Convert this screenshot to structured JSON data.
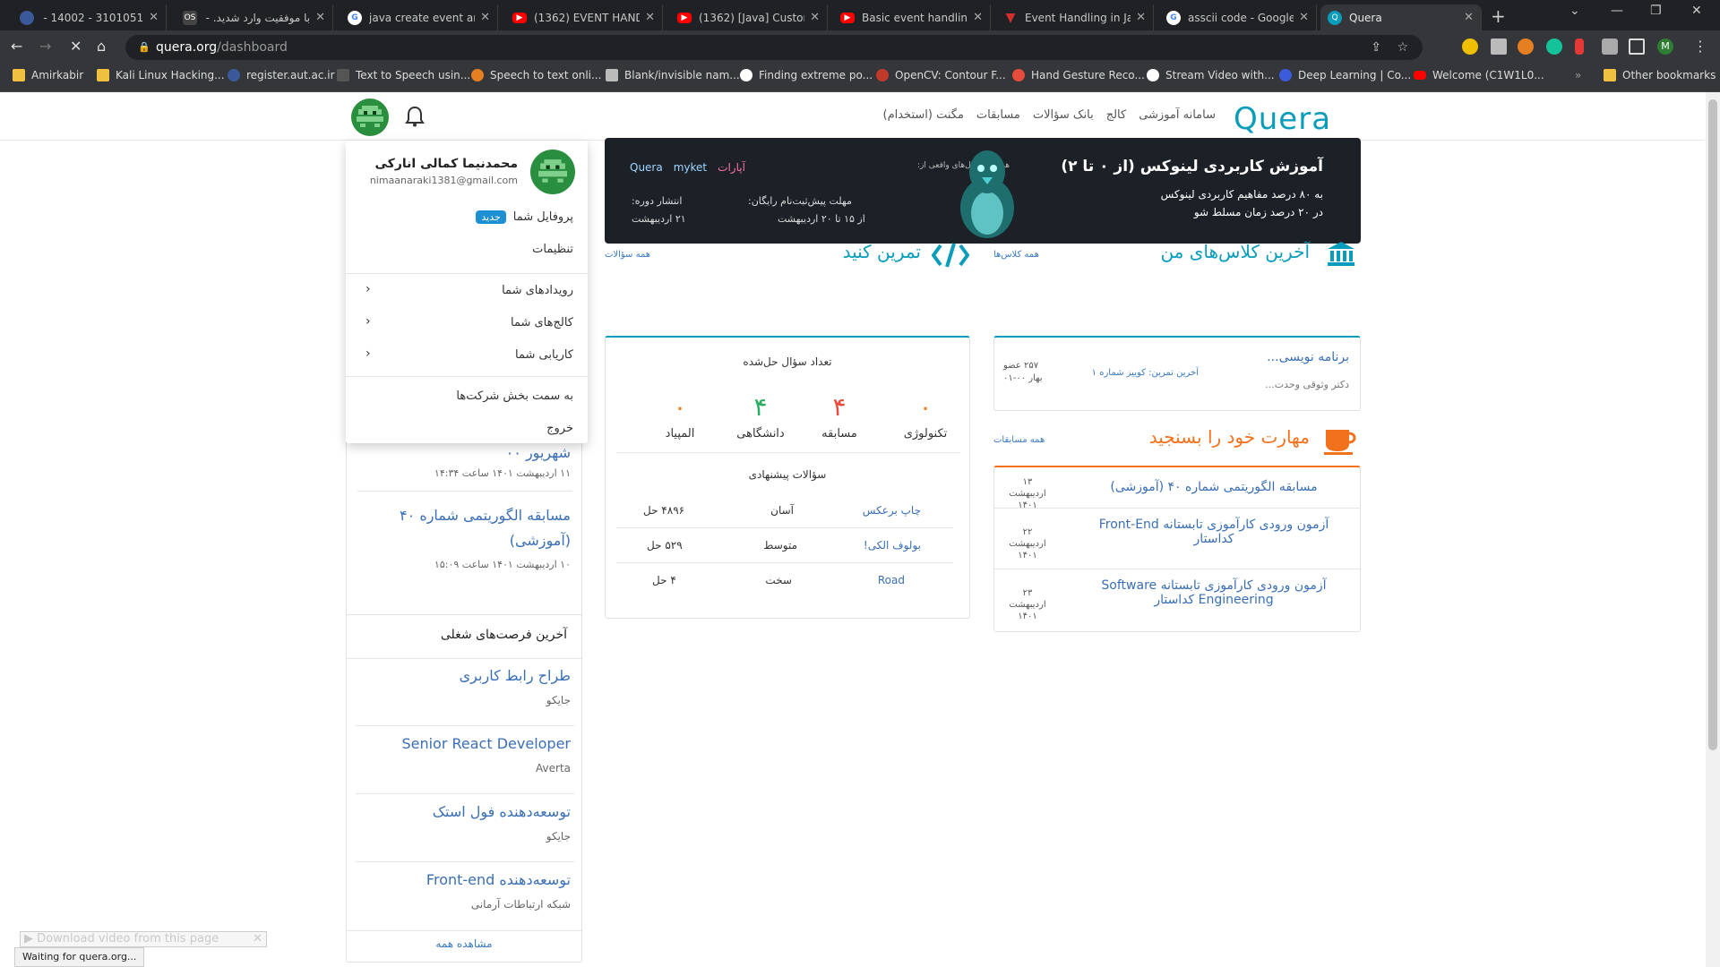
{
  "browser": {
    "tabs": [
      {
        "title": "3101051 - 14002 - کار",
        "icon": "aut-icon",
        "color": "#3b5998"
      },
      {
        "title": "با موفقیت وارد شدید. -",
        "icon": "os-icon",
        "color": "#444444"
      },
      {
        "title": "java create event and l",
        "icon": "google-icon",
        "color": "#4285f4"
      },
      {
        "title": "(1362) EVENT HANDLI",
        "icon": "youtube-icon",
        "color": "#ff0000"
      },
      {
        "title": "(1362) [Java] Custom E",
        "icon": "youtube-icon",
        "color": "#ff0000"
      },
      {
        "title": "Basic event handling i",
        "icon": "youtube-icon",
        "color": "#ff0000"
      },
      {
        "title": "Event Handling in Java",
        "icon": "v-icon",
        "color": "#d32f2f"
      },
      {
        "title": "asscii code - Google S",
        "icon": "google-icon",
        "color": "#4285f4"
      },
      {
        "title": "Quera",
        "icon": "quera-icon",
        "color": "#0a9dbb"
      }
    ],
    "url_host": "quera.org",
    "url_path": "/dashboard",
    "bookmarks": [
      {
        "label": "Amirkabir",
        "color": "#f0c040"
      },
      {
        "label": "Kali Linux Hacking...",
        "color": "#f0c040"
      },
      {
        "label": "register.aut.ac.ir",
        "color": "#3b5998"
      },
      {
        "label": "Text to Speech usin...",
        "color": "#555555"
      },
      {
        "label": "Speech to text onli...",
        "color": "#e67e22"
      },
      {
        "label": "Blank/invisible nam...",
        "color": "#bbbbbb"
      },
      {
        "label": "Finding extreme po...",
        "color": "#ffffff"
      },
      {
        "label": "OpenCV: Contour F...",
        "color": "#c0392b"
      },
      {
        "label": "Hand Gesture Reco...",
        "color": "#e74c3c"
      },
      {
        "label": "Stream Video with...",
        "color": "#ffffff"
      },
      {
        "label": "Deep Learning | Co...",
        "color": "#3b5bdb"
      },
      {
        "label": "Welcome (C1W1L0...",
        "color": "#ff0000"
      }
    ],
    "other_bookmarks": "Other bookmarks",
    "status_text": "Waiting for quera.org...",
    "download_bar": "Download video from this page"
  },
  "header": {
    "logo": "Quera",
    "menu": [
      "سامانه آموزشی",
      "کالج",
      "بانک سؤالات",
      "مسابقات",
      "مگنت (استخدام)"
    ]
  },
  "dropdown": {
    "name": "محمدنیما کمالی اناركی",
    "email": "nimaanaraki1381@gmail.com",
    "profile": "پروفایل شما",
    "profile_badge": "جدید",
    "settings": "تنظیمات",
    "events": "رویدادهای شما",
    "colleges": "کالج‌های شما",
    "jobs": "کاریابی شما",
    "companies": "به سمت بخش شرکت‌ها",
    "logout": "خروج"
  },
  "banner": {
    "title": "آموزش کاربردی لینوکس (از ۰ تا ۲)",
    "sub1": "به ۸۰ درصد مفاهیم کاربردی لینوکس",
    "sub2": "در ۲۰ درصد زمان مسلط شو",
    "top": "همراه با مثال‌های واقعی از:",
    "logo1": "Quera",
    "logo2": "myket",
    "logo3": "آپارات",
    "reg1": "مهلت پیش‌ثبت‌نام رایگان:",
    "reg2": "از ۱۵ تا ۲۰ اردیبهشت",
    "pub1": "انتشار دوره:",
    "pub2": "۲۱ اردیبهشت"
  },
  "classes": {
    "title": "آخرین کلاس‌های من",
    "all": "همه کلاس‌ها",
    "item_title": "برنامه نویسی...",
    "item_last": "آخرین تمرین: کوییز شماره ۱",
    "item_teacher": "دکتر وثوقی وحدت...",
    "item_members": "۲۵۷ عضو",
    "item_term": "بهار ۰۰-۰۱"
  },
  "practice": {
    "title": "تمرین کنید",
    "all": "همه سؤالات",
    "solved_title": "تعداد سؤال حل‌شده",
    "stats": [
      {
        "n": "۰",
        "label": "تکنولوژی",
        "color": "#e67e22"
      },
      {
        "n": "۴",
        "label": "مسابقه",
        "color": "#e74c3c"
      },
      {
        "n": "۴",
        "label": "دانشگاهی",
        "color": "#27ae60"
      },
      {
        "n": "۰",
        "label": "المپیاد",
        "color": "#e67e22"
      }
    ],
    "suggested_title": "سؤالات پیشنهادی",
    "suggested": [
      {
        "name": "چاپ برعکس",
        "level": "آسان",
        "solved": "۴۸۹۶ حل"
      },
      {
        "name": "بولوف الکی!",
        "level": "متوسط",
        "solved": "۵۲۹ حل"
      },
      {
        "name": "Road",
        "level": "سخت",
        "solved": "۴ حل"
      }
    ]
  },
  "contests": {
    "title": "مهارت خود را بسنجید",
    "all": "همه مسابقات",
    "items": [
      {
        "title": "مسابقه الگوریتمی شماره ۴۰ (آموزشی)",
        "date1": "۱۳ اردیبهشت",
        "date2": "۱۴۰۱"
      },
      {
        "title": "آزمون ورودی کارآموزی تابستانه Front-End کداستار",
        "date1": "۲۲ اردیبهشت",
        "date2": "۱۴۰۱"
      },
      {
        "title": "آزمون ورودی کارآموزی تابستانه Software Engineering کداستار",
        "date1": "۲۳ اردیبهشت",
        "date2": "۱۴۰۱"
      }
    ]
  },
  "left_events": {
    "partial_title": "شهریور ۰۰",
    "partial_date": "۱۱ اردیبهشت ۱۴۰۱ ساعت ۱۴:۳۴",
    "event_title": "مسابقه الگوریتمی شماره ۴۰ (آموزشی)",
    "event_date": "۱۰ اردیبهشت ۱۴۰۱ ساعت ۱۵:۰۹"
  },
  "jobs": {
    "title": "آخرین فرصت‌های شغلی",
    "items": [
      {
        "title": "طراح رابط کاربری",
        "company": "جایکو"
      },
      {
        "title": "Senior React Developer",
        "company": "Averta"
      },
      {
        "title": "توسعه‌دهنده فول استک",
        "company": "جایکو"
      },
      {
        "title": "توسعه‌دهنده Front-end",
        "company": "شبکه ارتباطات آرمانی"
      }
    ],
    "see_all": "مشاهده همه"
  }
}
